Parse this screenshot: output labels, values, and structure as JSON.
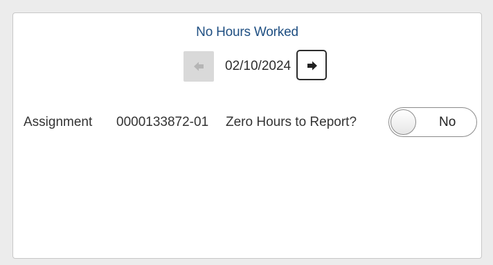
{
  "panel": {
    "title": "No Hours Worked",
    "date_nav": {
      "date": "02/10/2024",
      "prev_icon": "arrow-left-icon",
      "next_icon": "arrow-right-icon"
    },
    "row": {
      "assignment_label": "Assignment",
      "assignment_value": "0000133872-01",
      "zero_hours_label": "Zero Hours to Report?",
      "zero_hours_toggle": {
        "value": "No",
        "state": "off"
      }
    }
  },
  "colors": {
    "title": "#1f4f82",
    "page_bg": "#ececec",
    "panel_bg": "#ffffff",
    "disabled_button": "#d9d9d9"
  }
}
